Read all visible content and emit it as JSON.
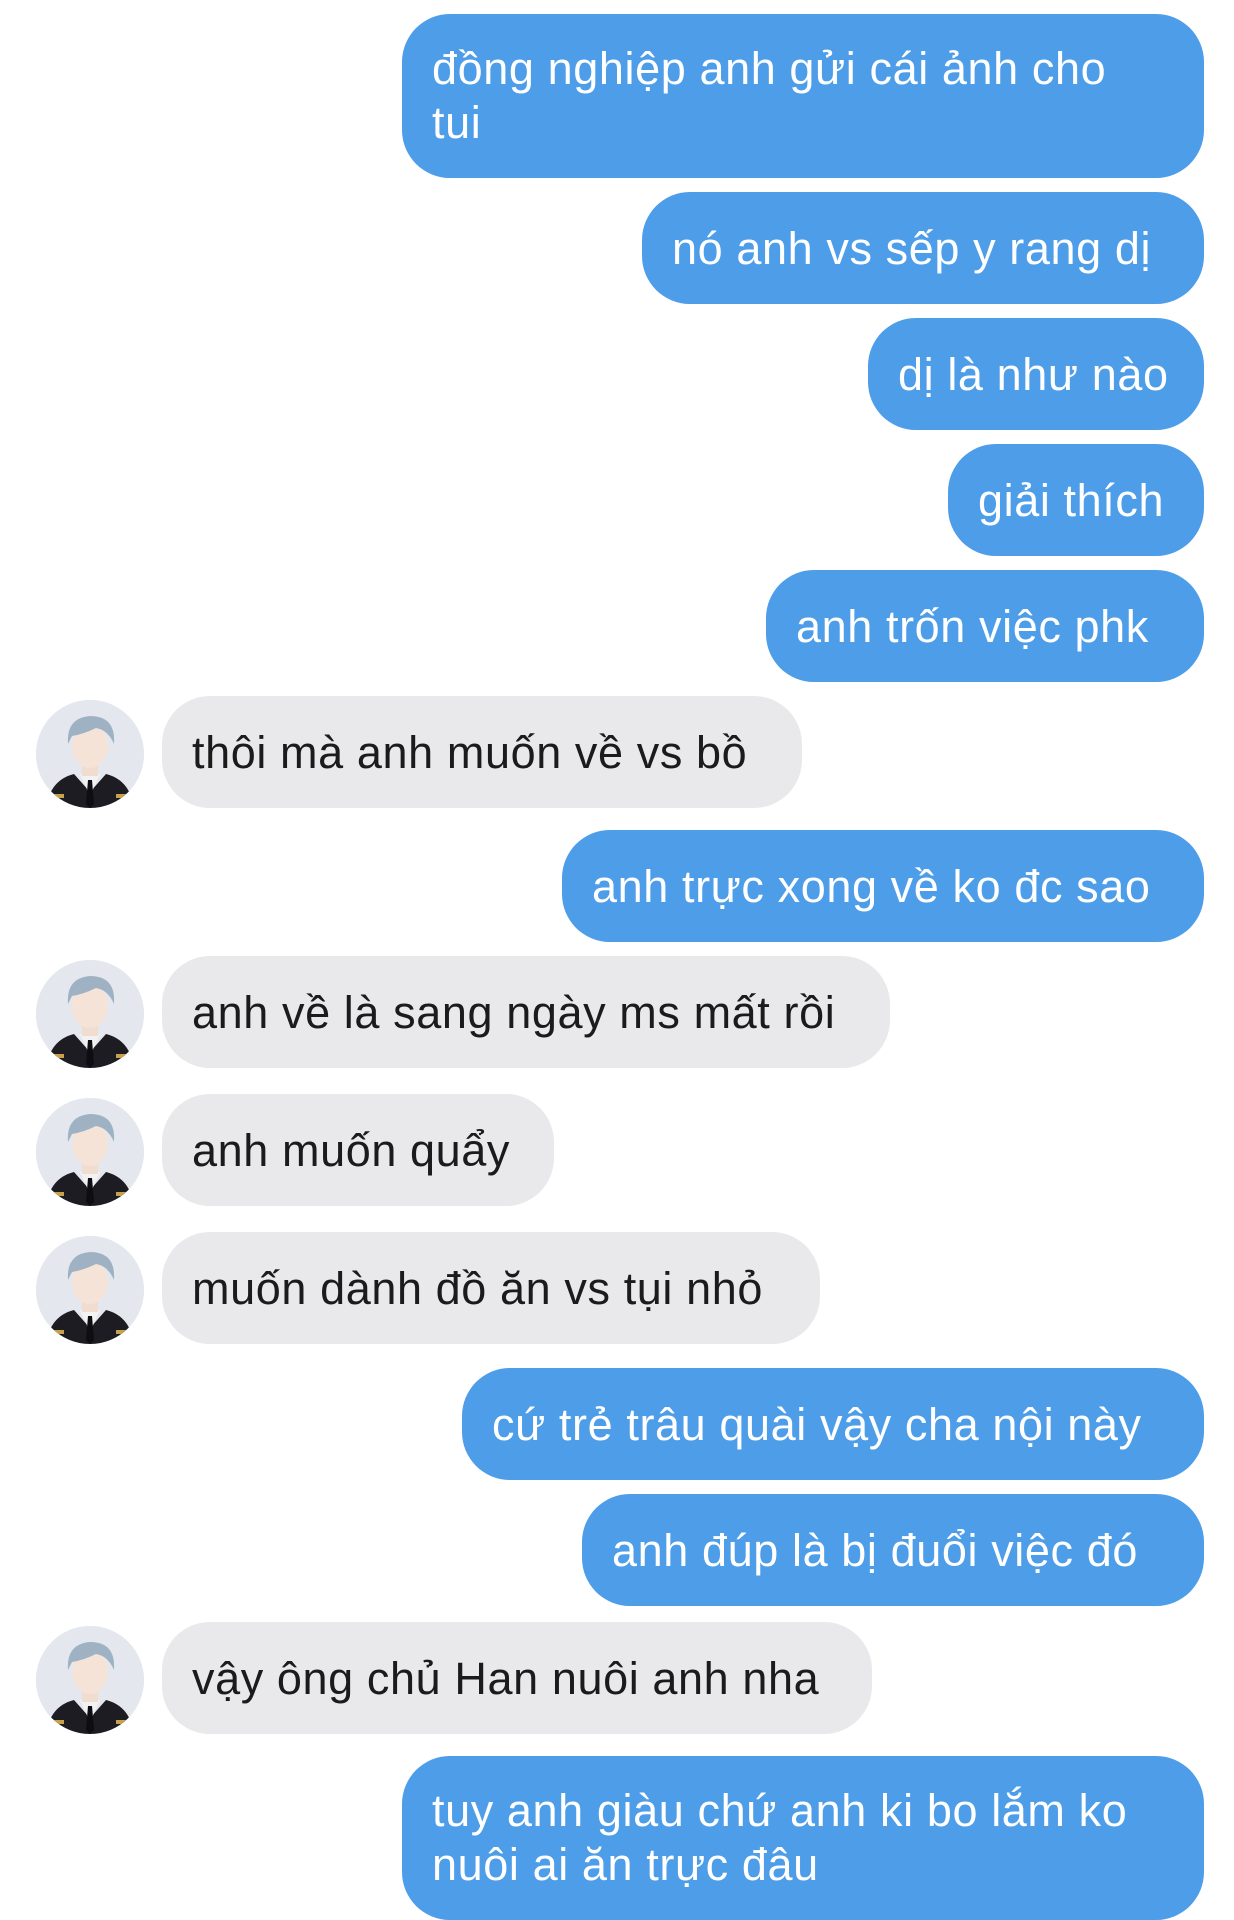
{
  "messages": [
    {
      "side": "out",
      "text": "đồng nghiệp anh gửi cái ảnh cho\ntui"
    },
    {
      "side": "out",
      "text": "nó anh vs sếp y rang dị"
    },
    {
      "side": "out",
      "text": "dị là như nào"
    },
    {
      "side": "out",
      "text": "giải thích"
    },
    {
      "side": "out",
      "text": "anh trốn việc phk"
    },
    {
      "side": "in",
      "text": "thôi mà anh muốn về vs bồ"
    },
    {
      "side": "out",
      "text": "anh trực xong về ko đc sao"
    },
    {
      "side": "in",
      "text": "anh về là sang ngày ms mất rồi"
    },
    {
      "side": "in",
      "text": "anh muốn quẩy"
    },
    {
      "side": "in",
      "text": "muốn dành đồ ăn vs tụi nhỏ"
    },
    {
      "side": "out",
      "text": "cứ trẻ trâu quài vậy cha nội này"
    },
    {
      "side": "out",
      "text": "anh đúp là bị đuổi việc đó"
    },
    {
      "side": "in",
      "text": "vậy ông chủ Han nuôi anh nha"
    },
    {
      "side": "out",
      "text": "tuy anh giàu chứ anh ki bo lắm ko\nnuôi ai ăn trực đâu"
    }
  ],
  "colors": {
    "outgoing_bubble": "#4d9de9",
    "incoming_bubble": "#e9e9eb",
    "outgoing_text": "#ffffff",
    "incoming_text": "#1b1b1b"
  },
  "icons": {
    "contact_avatar": "person-avatar-icon"
  }
}
